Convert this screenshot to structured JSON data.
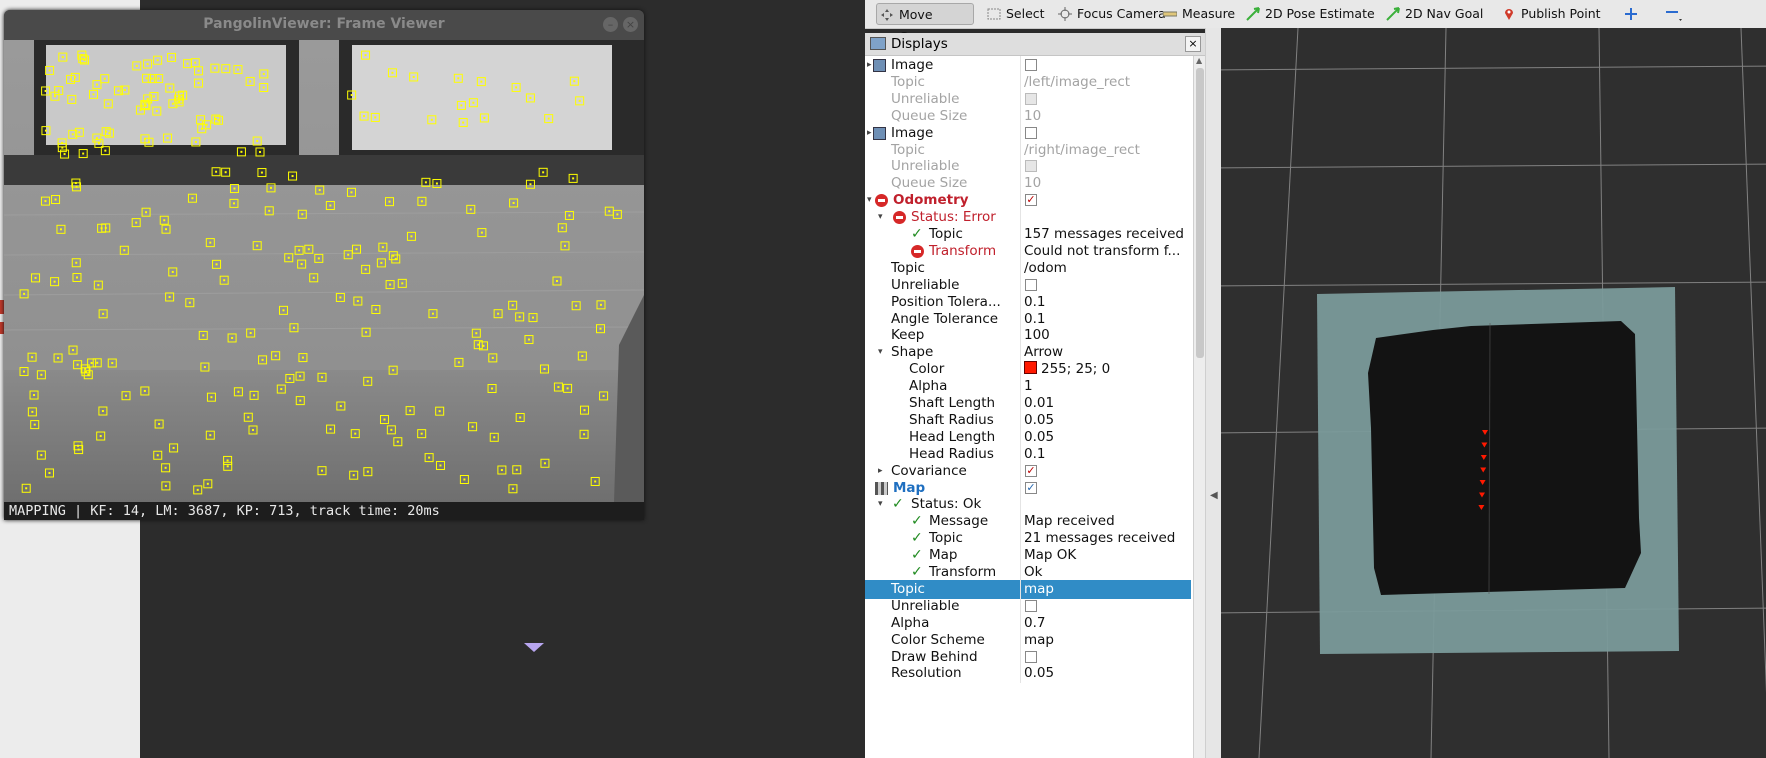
{
  "pangolin": {
    "title": "PangolinViewer: Frame Viewer",
    "status": "MAPPING | KF: 14, LM: 3687, KP: 713, track time: 20ms",
    "keypoint_color": "#ffff00"
  },
  "toolbar": {
    "tools": [
      {
        "label": "Move Camera",
        "icon": "move-camera-icon"
      },
      {
        "label": "Select",
        "icon": "select-icon"
      },
      {
        "label": "Focus Camera",
        "icon": "focus-camera-icon"
      },
      {
        "label": "Measure",
        "icon": "measure-icon"
      },
      {
        "label": "2D Pose Estimate",
        "icon": "pose-estimate-icon"
      },
      {
        "label": "2D Nav Goal",
        "icon": "nav-goal-icon"
      },
      {
        "label": "Publish Point",
        "icon": "publish-point-icon"
      }
    ]
  },
  "displays": {
    "title": "Displays",
    "rows": [
      {
        "label": "Image",
        "value": "",
        "check": "off"
      },
      {
        "label": "Topic",
        "value": "/left/image_rect"
      },
      {
        "label": "Unreliable",
        "value": "",
        "check": "grey"
      },
      {
        "label": "Queue Size",
        "value": "10"
      },
      {
        "label": "Image",
        "value": "",
        "check": "off"
      },
      {
        "label": "Topic",
        "value": "/right/image_rect"
      },
      {
        "label": "Unreliable",
        "value": "",
        "check": "grey"
      },
      {
        "label": "Queue Size",
        "value": "10"
      },
      {
        "label": "Odometry",
        "value": "",
        "check": "on"
      },
      {
        "label": "Status: Error",
        "value": ""
      },
      {
        "label": "Topic",
        "value": "157 messages received"
      },
      {
        "label": "Transform",
        "value": "Could not transform f..."
      },
      {
        "label": "Topic",
        "value": "/odom"
      },
      {
        "label": "Unreliable",
        "value": "",
        "check": "off"
      },
      {
        "label": "Position Tolera...",
        "value": "0.1"
      },
      {
        "label": "Angle Tolerance",
        "value": "0.1"
      },
      {
        "label": "Keep",
        "value": "100"
      },
      {
        "label": "Shape",
        "value": "Arrow"
      },
      {
        "label": "Color",
        "value": "255; 25; 0"
      },
      {
        "label": "Alpha",
        "value": "1"
      },
      {
        "label": "Shaft Length",
        "value": "0.01"
      },
      {
        "label": "Shaft Radius",
        "value": "0.05"
      },
      {
        "label": "Head Length",
        "value": "0.05"
      },
      {
        "label": "Head Radius",
        "value": "0.1"
      },
      {
        "label": "Covariance",
        "value": "",
        "check": "on"
      },
      {
        "label": "Map",
        "value": "",
        "check": "on"
      },
      {
        "label": "Status: Ok",
        "value": ""
      },
      {
        "label": "Message",
        "value": "Map received"
      },
      {
        "label": "Topic",
        "value": "21 messages received"
      },
      {
        "label": "Map",
        "value": "Map OK"
      },
      {
        "label": "Transform",
        "value": "Ok"
      },
      {
        "label": "Topic",
        "value": "map"
      },
      {
        "label": "Unreliable",
        "value": "",
        "check": "off"
      },
      {
        "label": "Alpha",
        "value": "0.7"
      },
      {
        "label": "Color Scheme",
        "value": "map"
      },
      {
        "label": "Draw Behind",
        "value": "",
        "check": "off"
      },
      {
        "label": "Resolution",
        "value": "0.05"
      }
    ]
  },
  "colors": {
    "error": "#c0202c",
    "ok": "#1f8a1f",
    "selected_row": "#308cc6",
    "odom_color": "#ff1900",
    "map_floor": "#7a9a9a"
  }
}
